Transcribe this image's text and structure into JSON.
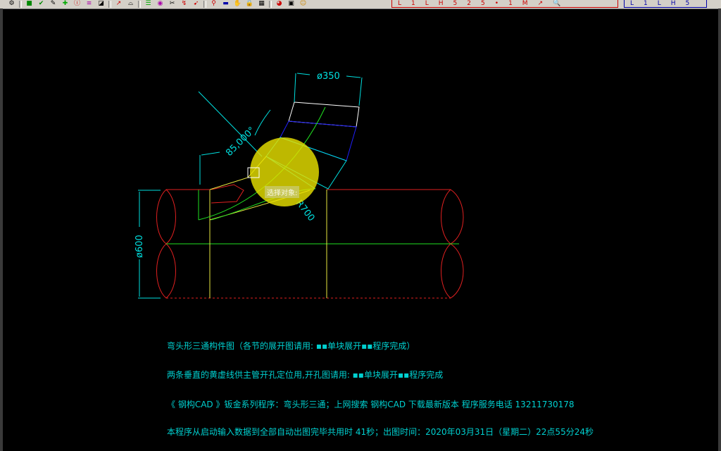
{
  "toolbar": {
    "redbar_items": [
      "L",
      "1",
      "L",
      "H",
      "5",
      "2",
      "5",
      "•",
      "1",
      "M",
      "↗",
      "🔍"
    ],
    "bluebar_items": [
      "L",
      "1",
      "L",
      "H",
      "5"
    ]
  },
  "drawing": {
    "dim_top": "ø350",
    "dim_angle": "85,000°",
    "dim_radius": "R700",
    "dim_diameter": "ø600",
    "cursor_prompt": "选择对象:"
  },
  "notes": [
    "弯头形三通构件图（各节的展开图请用: ▪▪单块展开▪▪程序完成）",
    "两条垂直的黄虚线供主管开孔定位用,开孔图请用: ▪▪单块展开▪▪程序完成",
    "《 钢构CAD 》钣金系列程序：弯头形三通；上网搜索  钢构CAD  下载最新版本   程序服务电话  13211730178",
    "本程序从启动输入数据到全部自动出图完毕共用时  41秒；出图时间：2020年03月31日（星期二）22点55分24秒"
  ],
  "colors": {
    "cyan": "#00e0e0",
    "red": "#e02020",
    "green": "#20e020",
    "yellow": "#e8e840",
    "blue": "#2020ff",
    "white": "#ffffff",
    "highlight": "#e8e000"
  }
}
